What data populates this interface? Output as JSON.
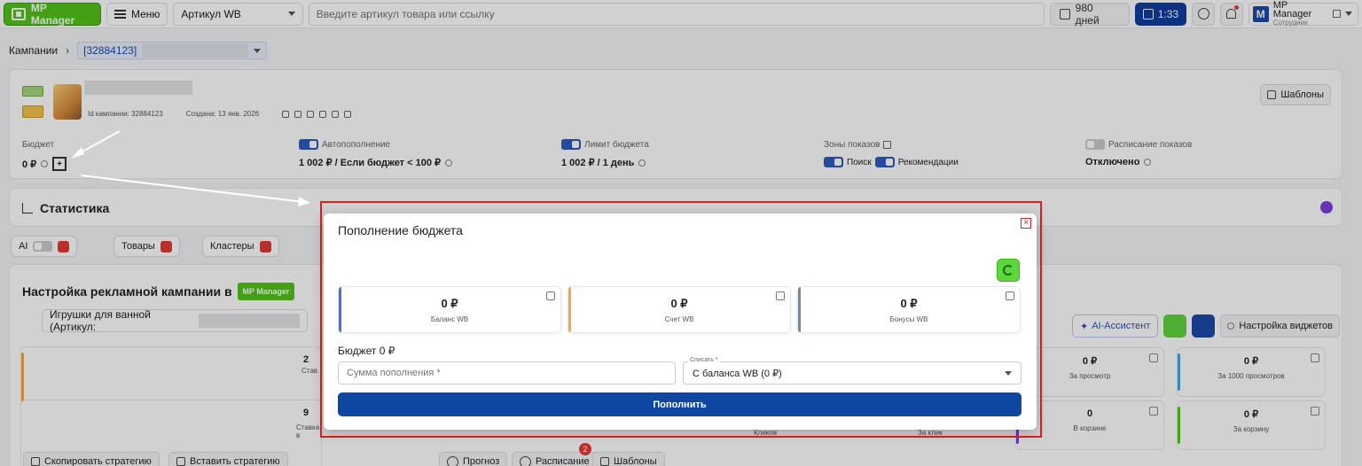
{
  "topbar": {
    "logo_label": "MP Manager",
    "menu_label": "Меню",
    "article_select": "Артикул WB",
    "search_placeholder": "Введите артикул товара или ссылку",
    "days_label": "980 дней",
    "timer_label": "1:33",
    "user_initial": "M",
    "user_name": "MP Manager",
    "user_sub": "Сотрудник"
  },
  "breadcrumb": {
    "root": "Кампании",
    "arrow": "›",
    "campaign_id": "[32884123]"
  },
  "campaign": {
    "id_label": "Id кампании: 32884123",
    "created_label": "Создана: 13 янв. 2026",
    "templates_button": "Шаблоны",
    "budget_label": "Бюджет",
    "budget_value": "0 ₽",
    "budget_add": "+",
    "autorefill_label": "Автопополнение",
    "autorefill_value": "1 002 ₽ / Если бюджет < 100 ₽",
    "limit_label": "Лимит бюджета",
    "limit_value": "1 002 ₽ / 1 день",
    "zones_label": "Зоны показов",
    "zone_search": "Поиск",
    "zone_recs": "Рекомендации",
    "schedule_label": "Расписание показов",
    "schedule_value": "Отключено"
  },
  "statistics": {
    "title": "Статистика"
  },
  "pills": {
    "ai": "AI",
    "goods": "Товары",
    "clusters": "Кластеры"
  },
  "setup": {
    "title": "Настройка рекламной кампании в",
    "logo": "MP Manager",
    "product_prefix": "Игрушки для ванной (Артикул:",
    "ai_assistant": "AI-Ассистент",
    "widgets_button": "Настройка виджетов",
    "tiles": [
      {
        "value": "0 ₽",
        "label": "За просмотр"
      },
      {
        "value": "0 ₽",
        "label": "За 1000 просмотров"
      },
      {
        "value": "0",
        "label": "В корзине"
      },
      {
        "value": "0 ₽",
        "label": "За корзину"
      }
    ],
    "hidden_partial": [
      "Кликов",
      "За клик"
    ],
    "left_stub_1": "2",
    "left_stub_1_label": "Став",
    "left_stub_2": "9",
    "left_stub_2_label": "Ставка в",
    "copy_strategy": "Скопировать стратегию",
    "paste_strategy": "Вставить стратегию",
    "forecast": "Прогноз",
    "schedule": "Расписание",
    "schedule_badge": "2",
    "templates": "Шаблоны"
  },
  "modal": {
    "title": "Пополнение бюджета",
    "close": "×",
    "balances": [
      {
        "value": "0 ₽",
        "label": "Баланс WB",
        "color": "#5b6bb5"
      },
      {
        "value": "0 ₽",
        "label": "Счет WB",
        "color": "#f0a84a"
      },
      {
        "value": "0 ₽",
        "label": "Бонусы WB",
        "color": "#7a8a94"
      }
    ],
    "budget_text": "Бюджет 0 ₽",
    "amount_placeholder": "Сумма пополнения *",
    "source_label": "Списать *",
    "source_value": "С баланса WB (0 ₽)",
    "submit": "Пополнить"
  },
  "colors": {
    "brand_green": "#52c41a",
    "primary_blue": "#0d47a1",
    "highlight_red": "#e0201a"
  }
}
